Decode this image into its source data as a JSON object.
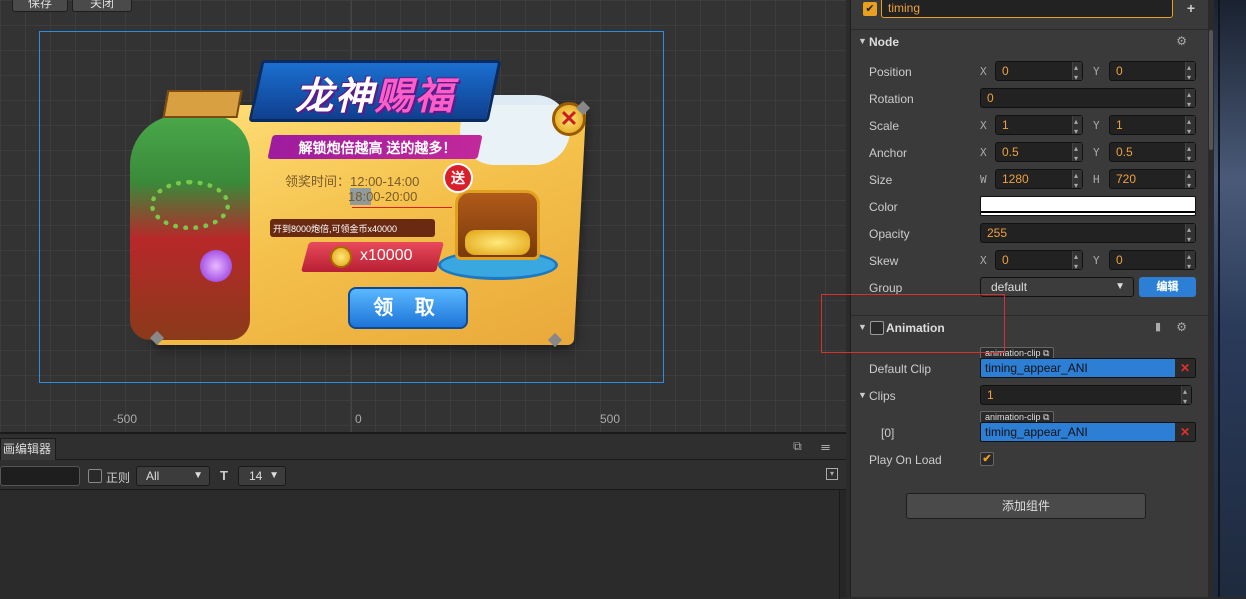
{
  "scene": {
    "save_label": "保存",
    "close_label": "关闭",
    "axis_labels": [
      "-500",
      "0",
      "500"
    ],
    "popup": {
      "title_part1": "龙神",
      "title_part2": "赐福",
      "subtitle": "解锁炮倍越高  送的越多！",
      "time_label": "领奖时间：12:00-14:00",
      "time_label_2": "18:00-20:00",
      "unlock_text": "开到8000炮倍,可领金币x40000",
      "reward": "x10000",
      "badge": "送",
      "claim_label": "领 取",
      "close_glyph": "✕"
    }
  },
  "anim_panel": {
    "tab_label": "画编辑器",
    "regex_label": "正则",
    "filter_value": "All",
    "font_icon": "T",
    "font_size": "14",
    "tab_icons": "⧉ ☰"
  },
  "inspector": {
    "node_name": "timing",
    "node_section": "Node",
    "props": {
      "position": {
        "label": "Position",
        "x": "0",
        "y": "0"
      },
      "rotation": {
        "label": "Rotation",
        "value": "0"
      },
      "scale": {
        "label": "Scale",
        "x": "1",
        "y": "1"
      },
      "anchor": {
        "label": "Anchor",
        "x": "0.5",
        "y": "0.5"
      },
      "size": {
        "label": "Size",
        "w": "1280",
        "h": "720"
      },
      "color": {
        "label": "Color",
        "value": "#ffffff"
      },
      "opacity": {
        "label": "Opacity",
        "value": "255"
      },
      "skew": {
        "label": "Skew",
        "x": "0",
        "y": "0"
      },
      "group": {
        "label": "Group",
        "value": "default",
        "edit_label": "编辑"
      }
    },
    "axis": {
      "x": "X",
      "y": "Y",
      "w": "W",
      "h": "H"
    },
    "animation": {
      "title": "Animation",
      "default_clip_label": "Default Clip",
      "asset_tag": "animation-clip",
      "default_clip_value": "timing_appear_ANI",
      "clips_label": "Clips",
      "clips_count": "1",
      "clip0_label": "[0]",
      "clip0_value": "timing_appear_ANI",
      "play_on_load_label": "Play On Load"
    },
    "add_component_label": "添加组件"
  },
  "colors": {
    "accent": "#2d7fd6",
    "value_orange": "#f0a040",
    "highlight_red": "#d83030"
  }
}
